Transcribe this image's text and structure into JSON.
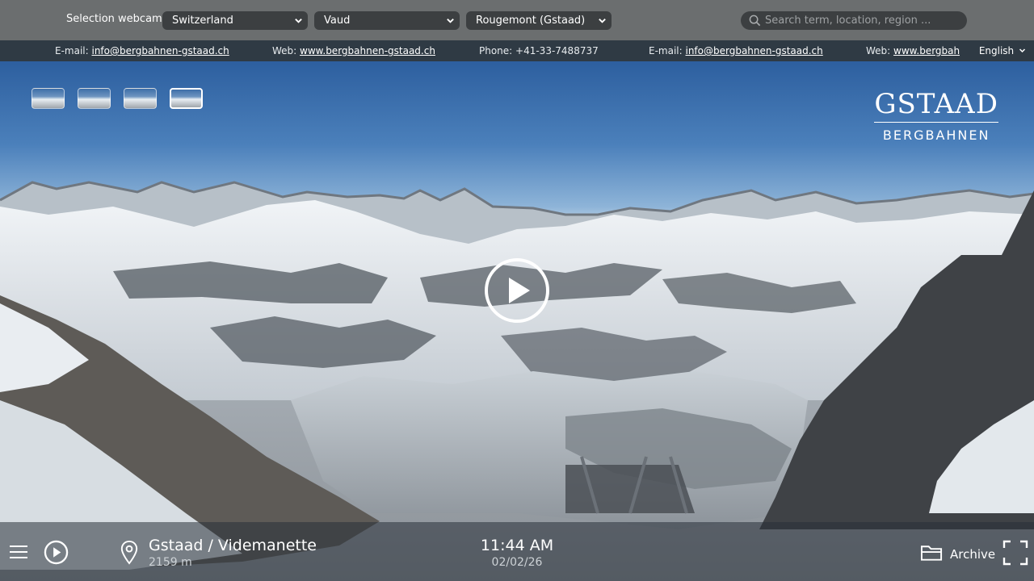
{
  "topbar": {
    "selection_label": "Selection webcam:",
    "country": "Switzerland",
    "region": "Vaud",
    "place": "Rougemont (Gstaad)",
    "search_placeholder": "Search term, location, region ..."
  },
  "ticker": {
    "items": [
      {
        "label": "E-mail: ",
        "value": "info@bergbahnen-gstaad.ch"
      },
      {
        "label": "Web: ",
        "value": "www.bergbahnen-gstaad.ch"
      },
      {
        "label": "Phone: +41-33-7488737",
        "value": ""
      },
      {
        "label": "E-mail: ",
        "value": "info@bergbahnen-gstaad.ch"
      },
      {
        "label": "Web: ",
        "value": "www.bergbahne"
      }
    ],
    "language": "English"
  },
  "logo": {
    "line1": "GSTAAD",
    "line2": "BERGBAHNEN"
  },
  "bottom": {
    "camera_name": "Gstaad / Videmanette",
    "altitude": "2159 m",
    "time": "11:44 AM",
    "date": "02/02/26",
    "archive_label": "Archive"
  },
  "icons": {
    "menu": "hamburger-menu-icon",
    "play": "play-icon",
    "location": "map-pin-icon",
    "archive": "folder-icon",
    "fullscreen": "fullscreen-icon",
    "search": "search-icon"
  }
}
